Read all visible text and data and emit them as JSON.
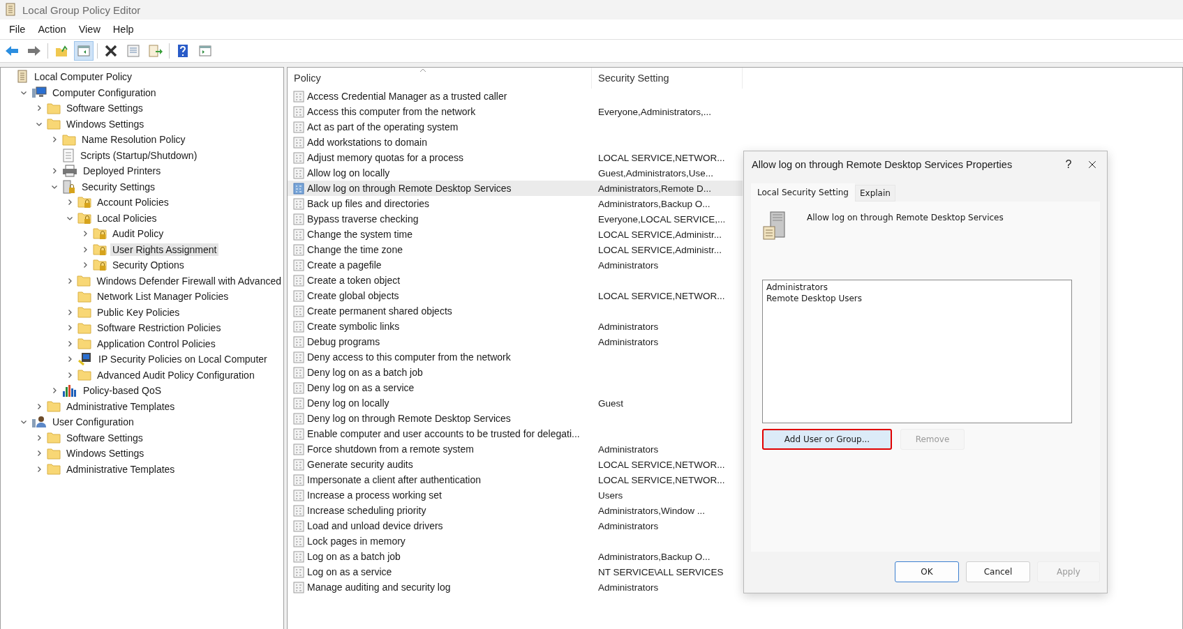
{
  "window": {
    "title": "Local Group Policy Editor"
  },
  "menu": [
    "File",
    "Action",
    "View",
    "Help"
  ],
  "toolbar": [
    [
      {
        "kind": "back",
        "pressed": false
      },
      {
        "kind": "forward",
        "pressed": false
      }
    ],
    [
      {
        "kind": "up",
        "pressed": false
      },
      {
        "kind": "tree",
        "pressed": true
      }
    ],
    [
      {
        "kind": "delete",
        "pressed": false
      },
      {
        "kind": "properties",
        "pressed": false
      },
      {
        "kind": "export",
        "pressed": false
      }
    ],
    [
      {
        "kind": "help",
        "pressed": false
      },
      {
        "kind": "pane",
        "pressed": false
      }
    ]
  ],
  "tree": [
    {
      "label": "Local Computer Policy",
      "kind": "scroll",
      "selected": false,
      "children": [
        {
          "label": "Computer Configuration",
          "kind": "computer",
          "expandable": true,
          "expanded": true,
          "selected": false,
          "children": [
            {
              "label": "Software Settings",
              "kind": "folder",
              "expandable": true,
              "expanded": false,
              "selected": false
            },
            {
              "label": "Windows Settings",
              "kind": "folder",
              "expandable": true,
              "expanded": true,
              "selected": false,
              "children": [
                {
                  "label": "Name Resolution Policy",
                  "kind": "folder",
                  "expandable": true,
                  "expanded": false,
                  "selected": false
                },
                {
                  "label": "Scripts (Startup/Shutdown)",
                  "kind": "script",
                  "selected": false
                },
                {
                  "label": "Deployed Printers",
                  "kind": "printer",
                  "expandable": true,
                  "expanded": false,
                  "selected": false
                },
                {
                  "label": "Security Settings",
                  "kind": "security",
                  "expandable": true,
                  "expanded": true,
                  "selected": false,
                  "children": [
                    {
                      "label": "Account Policies",
                      "kind": "locked",
                      "expandable": true,
                      "expanded": false,
                      "selected": false
                    },
                    {
                      "label": "Local Policies",
                      "kind": "locked",
                      "expandable": true,
                      "expanded": true,
                      "selected": false,
                      "children": [
                        {
                          "label": "Audit Policy",
                          "kind": "locked",
                          "expandable": true,
                          "expanded": false,
                          "selected": false
                        },
                        {
                          "label": "User Rights Assignment",
                          "kind": "locked",
                          "expandable": true,
                          "expanded": false,
                          "selected": true
                        },
                        {
                          "label": "Security Options",
                          "kind": "locked",
                          "expandable": true,
                          "expanded": false,
                          "selected": false
                        }
                      ]
                    },
                    {
                      "label": "Windows Defender Firewall with Advanced",
                      "kind": "folder",
                      "expandable": true,
                      "expanded": false,
                      "selected": false
                    },
                    {
                      "label": "Network List Manager Policies",
                      "kind": "folder",
                      "selected": false
                    },
                    {
                      "label": "Public Key Policies",
                      "kind": "folder",
                      "expandable": true,
                      "expanded": false,
                      "selected": false
                    },
                    {
                      "label": "Software Restriction Policies",
                      "kind": "folder",
                      "expandable": true,
                      "expanded": false,
                      "selected": false
                    },
                    {
                      "label": "Application Control Policies",
                      "kind": "folder",
                      "expandable": true,
                      "expanded": false,
                      "selected": false
                    },
                    {
                      "label": "IP Security Policies on Local Computer",
                      "kind": "ipsec",
                      "expandable": true,
                      "expanded": false,
                      "selected": false
                    },
                    {
                      "label": "Advanced Audit Policy Configuration",
                      "kind": "folder",
                      "expandable": true,
                      "expanded": false,
                      "selected": false
                    }
                  ]
                },
                {
                  "label": "Policy-based QoS",
                  "kind": "qos",
                  "expandable": true,
                  "expanded": false,
                  "selected": false
                }
              ]
            },
            {
              "label": "Administrative Templates",
              "kind": "folder",
              "expandable": true,
              "expanded": false,
              "selected": false
            }
          ]
        },
        {
          "label": "User Configuration",
          "kind": "users",
          "expandable": true,
          "expanded": true,
          "selected": false,
          "children": [
            {
              "label": "Software Settings",
              "kind": "folder",
              "expandable": true,
              "expanded": false,
              "selected": false
            },
            {
              "label": "Windows Settings",
              "kind": "folder",
              "expandable": true,
              "expanded": false,
              "selected": false
            },
            {
              "label": "Administrative Templates",
              "kind": "folder",
              "expandable": true,
              "expanded": false,
              "selected": false
            }
          ]
        }
      ]
    }
  ],
  "table": {
    "columns": [
      "Policy",
      "Security Setting"
    ],
    "rows": [
      {
        "policy": "Access Credential Manager as a trusted caller",
        "setting": "",
        "selected": false
      },
      {
        "policy": "Access this computer from the network",
        "setting": "Everyone,Administrators,...",
        "selected": false
      },
      {
        "policy": "Act as part of the operating system",
        "setting": "",
        "selected": false
      },
      {
        "policy": "Add workstations to domain",
        "setting": "",
        "selected": false
      },
      {
        "policy": "Adjust memory quotas for a process",
        "setting": "LOCAL SERVICE,NETWOR...",
        "selected": false
      },
      {
        "policy": "Allow log on locally",
        "setting": "Guest,Administrators,Use...",
        "selected": false
      },
      {
        "policy": "Allow log on through Remote Desktop Services",
        "setting": "Administrators,Remote D...",
        "selected": true
      },
      {
        "policy": "Back up files and directories",
        "setting": "Administrators,Backup O...",
        "selected": false
      },
      {
        "policy": "Bypass traverse checking",
        "setting": "Everyone,LOCAL SERVICE,...",
        "selected": false
      },
      {
        "policy": "Change the system time",
        "setting": "LOCAL SERVICE,Administr...",
        "selected": false
      },
      {
        "policy": "Change the time zone",
        "setting": "LOCAL SERVICE,Administr...",
        "selected": false
      },
      {
        "policy": "Create a pagefile",
        "setting": "Administrators",
        "selected": false
      },
      {
        "policy": "Create a token object",
        "setting": "",
        "selected": false
      },
      {
        "policy": "Create global objects",
        "setting": "LOCAL SERVICE,NETWOR...",
        "selected": false
      },
      {
        "policy": "Create permanent shared objects",
        "setting": "",
        "selected": false
      },
      {
        "policy": "Create symbolic links",
        "setting": "Administrators",
        "selected": false
      },
      {
        "policy": "Debug programs",
        "setting": "Administrators",
        "selected": false
      },
      {
        "policy": "Deny access to this computer from the network",
        "setting": "",
        "selected": false
      },
      {
        "policy": "Deny log on as a batch job",
        "setting": "",
        "selected": false
      },
      {
        "policy": "Deny log on as a service",
        "setting": "",
        "selected": false
      },
      {
        "policy": "Deny log on locally",
        "setting": "Guest",
        "selected": false
      },
      {
        "policy": "Deny log on through Remote Desktop Services",
        "setting": "",
        "selected": false
      },
      {
        "policy": "Enable computer and user accounts to be trusted for delegati...",
        "setting": "",
        "selected": false
      },
      {
        "policy": "Force shutdown from a remote system",
        "setting": "Administrators",
        "selected": false
      },
      {
        "policy": "Generate security audits",
        "setting": "LOCAL SERVICE,NETWOR...",
        "selected": false
      },
      {
        "policy": "Impersonate a client after authentication",
        "setting": "LOCAL SERVICE,NETWOR...",
        "selected": false
      },
      {
        "policy": "Increase a process working set",
        "setting": "Users",
        "selected": false
      },
      {
        "policy": "Increase scheduling priority",
        "setting": "Administrators,Window ...",
        "selected": false
      },
      {
        "policy": "Load and unload device drivers",
        "setting": "Administrators",
        "selected": false
      },
      {
        "policy": "Lock pages in memory",
        "setting": "",
        "selected": false
      },
      {
        "policy": "Log on as a batch job",
        "setting": "Administrators,Backup O...",
        "selected": false
      },
      {
        "policy": "Log on as a service",
        "setting": "NT SERVICE\\ALL SERVICES",
        "selected": false
      },
      {
        "policy": "Manage auditing and security log",
        "setting": "Administrators",
        "selected": false
      }
    ]
  },
  "dialog": {
    "title": "Allow log on through Remote Desktop Services Properties",
    "help": "?",
    "tabs": [
      {
        "label": "Local Security Setting",
        "selected": true
      },
      {
        "label": "Explain",
        "selected": false
      }
    ],
    "policy_name": "Allow log on through Remote Desktop Services",
    "members": [
      "Administrators",
      "Remote Desktop Users"
    ],
    "member_buttons": [
      {
        "label": "Add User or Group...",
        "disabled": false,
        "highlighted": true
      },
      {
        "label": "Remove",
        "disabled": true,
        "highlighted": false
      }
    ],
    "buttons": [
      {
        "label": "OK",
        "disabled": false,
        "default": true
      },
      {
        "label": "Cancel",
        "disabled": false,
        "default": false
      },
      {
        "label": "Apply",
        "disabled": true,
        "default": false
      }
    ]
  }
}
